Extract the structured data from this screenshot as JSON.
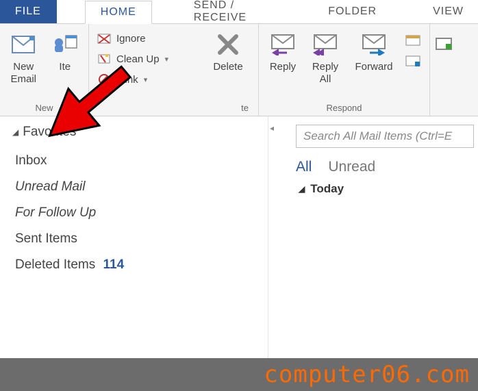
{
  "tabs": {
    "file": "FILE",
    "home": "HOME",
    "send_receive": "SEND / RECEIVE",
    "folder": "FOLDER",
    "view": "VIEW"
  },
  "ribbon": {
    "new_group": {
      "new_email": "New\nEmail",
      "new_items": "Ite",
      "label": "New"
    },
    "delete_group": {
      "ignore": "Ignore",
      "clean_up": "Clean Up",
      "junk": "Junk",
      "delete": "Delete",
      "label_partial": "te"
    },
    "respond_group": {
      "reply": "Reply",
      "reply_all": "Reply\nAll",
      "forward": "Forward",
      "label": "Respond"
    }
  },
  "folders": {
    "favorites_header": "Favorites",
    "inbox": "Inbox",
    "unread_mail": "Unread Mail",
    "for_follow_up": "For Follow Up",
    "sent_items": "Sent Items",
    "deleted_items": "Deleted Items",
    "deleted_count": "114"
  },
  "messages": {
    "search_placeholder": "Search All Mail Items (Ctrl=E",
    "filter_all": "All",
    "filter_unread": "Unread",
    "date_today": "Today"
  },
  "watermark": "computer06.com"
}
